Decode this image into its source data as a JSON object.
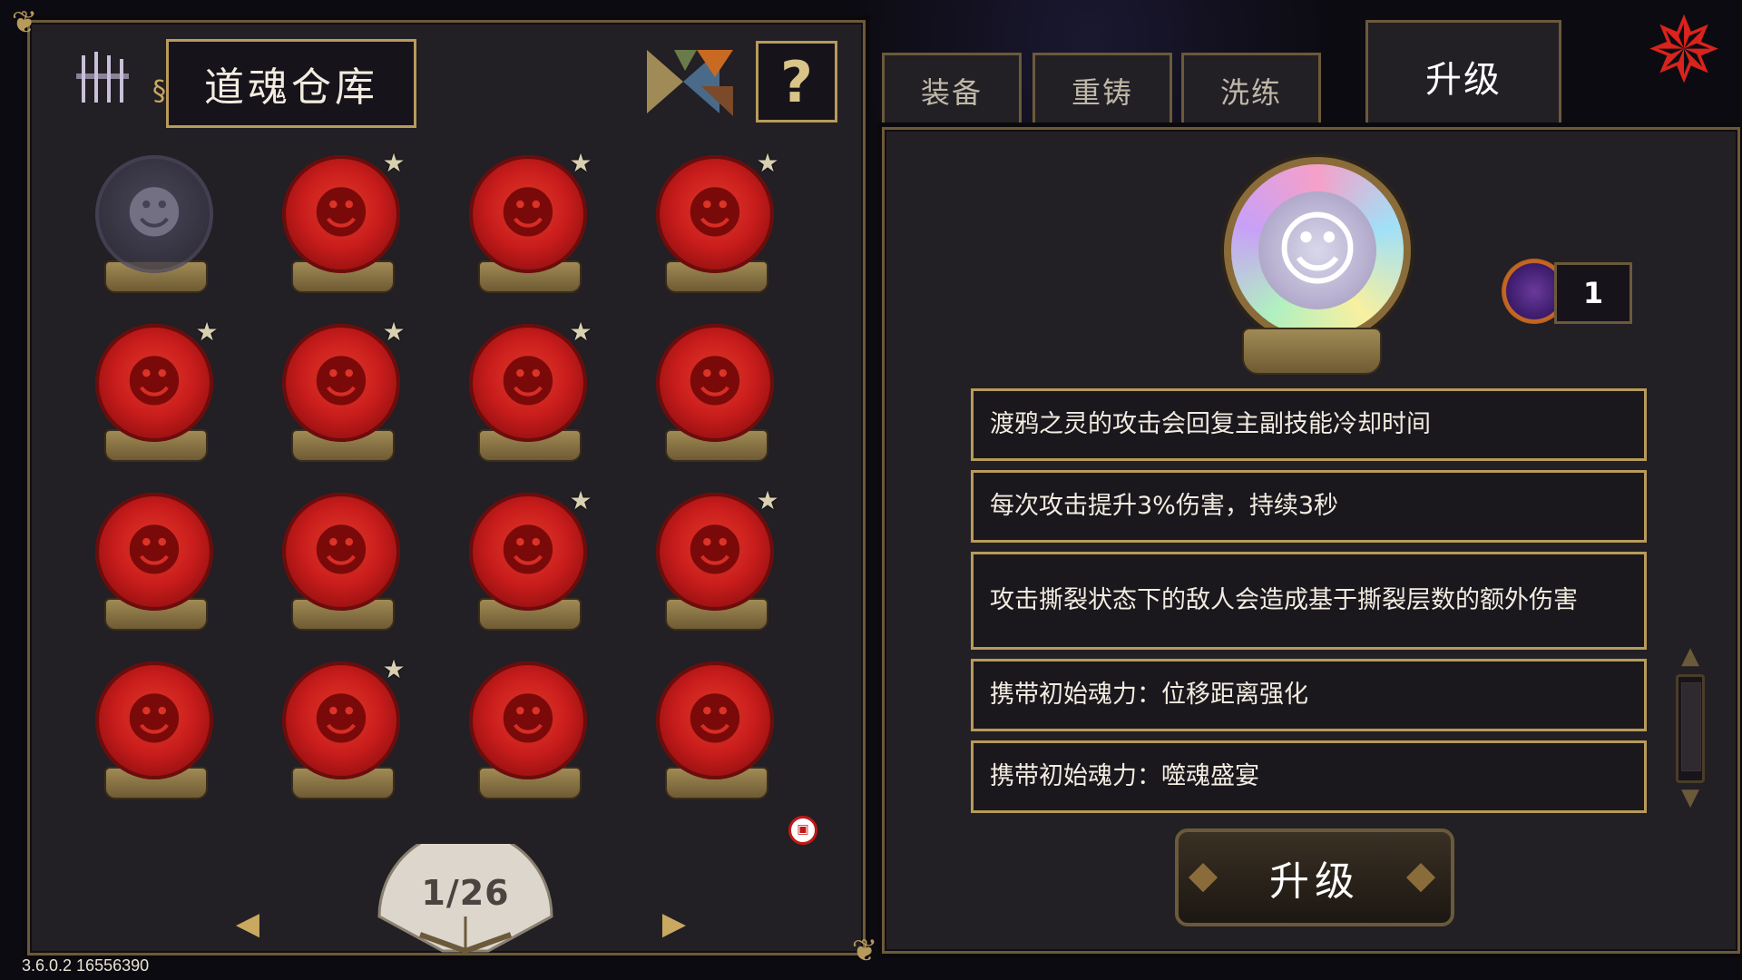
{
  "header": {
    "title": "道魂仓库",
    "help_label": "?"
  },
  "tabs": [
    {
      "label": "装备",
      "active": false
    },
    {
      "label": "重铸",
      "active": false
    },
    {
      "label": "洗练",
      "active": false
    },
    {
      "label": "升级",
      "active": true
    }
  ],
  "inventory": {
    "slots": [
      {
        "variant": "grey",
        "starred": false
      },
      {
        "variant": "red",
        "starred": true
      },
      {
        "variant": "red",
        "starred": true
      },
      {
        "variant": "red",
        "starred": true
      },
      {
        "variant": "red",
        "starred": true
      },
      {
        "variant": "red",
        "starred": true
      },
      {
        "variant": "red",
        "starred": true
      },
      {
        "variant": "red",
        "starred": false
      },
      {
        "variant": "red",
        "starred": false
      },
      {
        "variant": "red",
        "starred": false
      },
      {
        "variant": "red",
        "starred": true
      },
      {
        "variant": "red",
        "starred": true
      },
      {
        "variant": "red",
        "starred": false
      },
      {
        "variant": "red",
        "starred": true
      },
      {
        "variant": "red",
        "starred": false
      },
      {
        "variant": "red",
        "starred": false
      }
    ],
    "page_indicator": "1/26"
  },
  "detail": {
    "currency_count": "1",
    "descriptions": [
      "渡鸦之灵的攻击会回复主副技能冷却时间",
      "每次攻击提升3%伤害，持续3秒",
      "攻击撕裂状态下的敌人会造成基于撕裂层数的额外伤害",
      "携带初始魂力：位移距离强化",
      "携带初始魂力：噬魂盛宴"
    ],
    "upgrade_label": "升级"
  },
  "footer": {
    "version": "3.6.0.2 16556390"
  },
  "icons": {
    "star": "star-icon",
    "help": "question-mark-icon",
    "prev": "arrow-left-icon",
    "next": "arrow-right-icon",
    "lock": "lock-badge-icon",
    "pinwheel": "pinwheel-icon"
  },
  "colors": {
    "accent_gold": "#b89a5a",
    "orb_red": "#c91d1c",
    "panel": "#221f25"
  }
}
